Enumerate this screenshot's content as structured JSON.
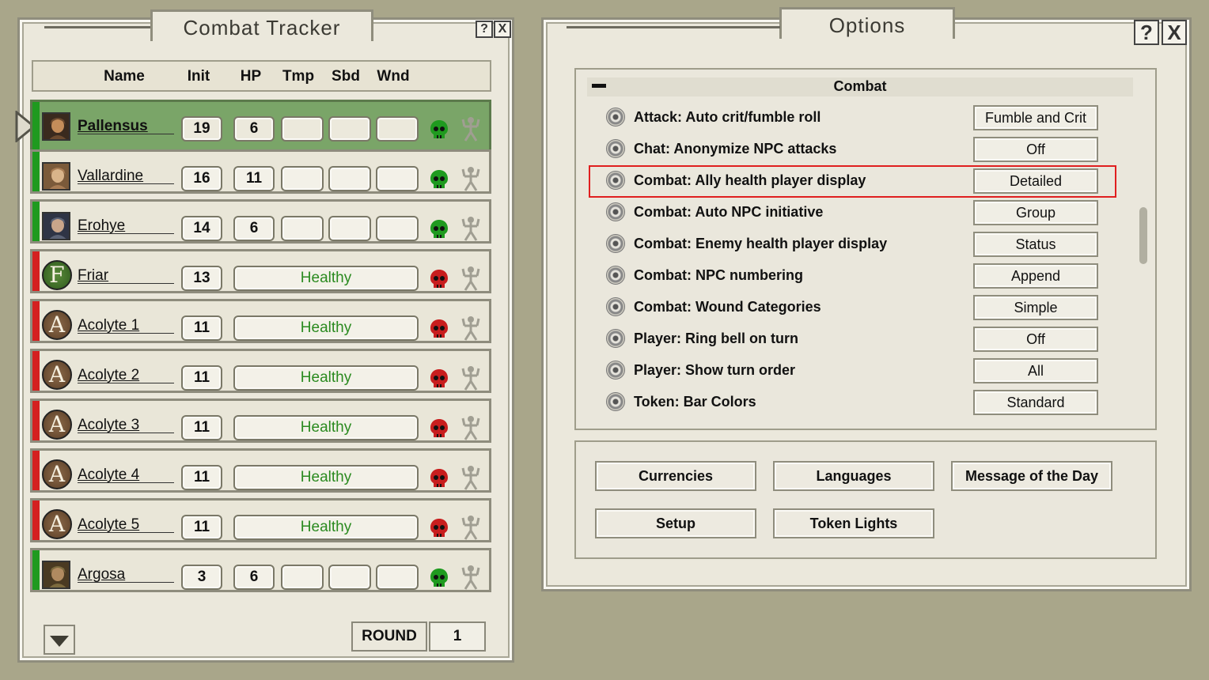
{
  "combat_tracker": {
    "title": "Combat Tracker",
    "help_label": "?",
    "close_label": "X",
    "columns": [
      "Name",
      "Init",
      "HP",
      "Tmp",
      "Sbd",
      "Wnd"
    ],
    "rows": [
      {
        "name": "Pallensus",
        "init": "19",
        "hp": "6",
        "status": "",
        "faction": "friend",
        "active": true
      },
      {
        "name": "Vallardine",
        "init": "16",
        "hp": "11",
        "status": "",
        "faction": "friend",
        "active": false
      },
      {
        "name": "Erohye",
        "init": "14",
        "hp": "6",
        "status": "",
        "faction": "friend",
        "active": false
      },
      {
        "name": "Friar",
        "init": "13",
        "hp": "",
        "status": "Healthy",
        "faction": "foe",
        "token_letter": "F",
        "active": false
      },
      {
        "name": "Acolyte 1",
        "init": "11",
        "hp": "",
        "status": "Healthy",
        "faction": "foe",
        "token_letter": "A",
        "active": false
      },
      {
        "name": "Acolyte 2",
        "init": "11",
        "hp": "",
        "status": "Healthy",
        "faction": "foe",
        "token_letter": "A",
        "active": false
      },
      {
        "name": "Acolyte 3",
        "init": "11",
        "hp": "",
        "status": "Healthy",
        "faction": "foe",
        "token_letter": "A",
        "active": false
      },
      {
        "name": "Acolyte 4",
        "init": "11",
        "hp": "",
        "status": "Healthy",
        "faction": "foe",
        "token_letter": "A",
        "active": false
      },
      {
        "name": "Acolyte 5",
        "init": "11",
        "hp": "",
        "status": "Healthy",
        "faction": "foe",
        "token_letter": "A",
        "active": false
      },
      {
        "name": "Argosa",
        "init": "3",
        "hp": "6",
        "status": "",
        "faction": "friend",
        "active": false
      }
    ],
    "round_label": "ROUND",
    "round_value": "1",
    "colors": {
      "friend": "#1f9a1f",
      "foe": "#d42020",
      "active_row": "#7aa568",
      "status_text": "#2a8a1f"
    }
  },
  "options": {
    "title": "Options",
    "help_label": "?",
    "close_label": "X",
    "group_title": "Combat",
    "items": [
      {
        "label": "Attack: Auto crit/fumble roll",
        "value": "Fumble and Crit"
      },
      {
        "label": "Chat: Anonymize NPC attacks",
        "value": "Off"
      },
      {
        "label": "Combat: Ally health player display",
        "value": "Detailed",
        "highlighted": true
      },
      {
        "label": "Combat: Auto NPC initiative",
        "value": "Group"
      },
      {
        "label": "Combat: Enemy health player display",
        "value": "Status"
      },
      {
        "label": "Combat: NPC numbering",
        "value": "Append"
      },
      {
        "label": "Combat: Wound Categories",
        "value": "Simple"
      },
      {
        "label": "Player: Ring bell on turn",
        "value": "Off"
      },
      {
        "label": "Player: Show turn order",
        "value": "All"
      },
      {
        "label": "Token: Bar Colors",
        "value": "Standard"
      }
    ],
    "buttons": [
      "Currencies",
      "Languages",
      "Message of the Day",
      "Setup",
      "Token Lights"
    ],
    "highlight_color": "#e01f1f"
  }
}
